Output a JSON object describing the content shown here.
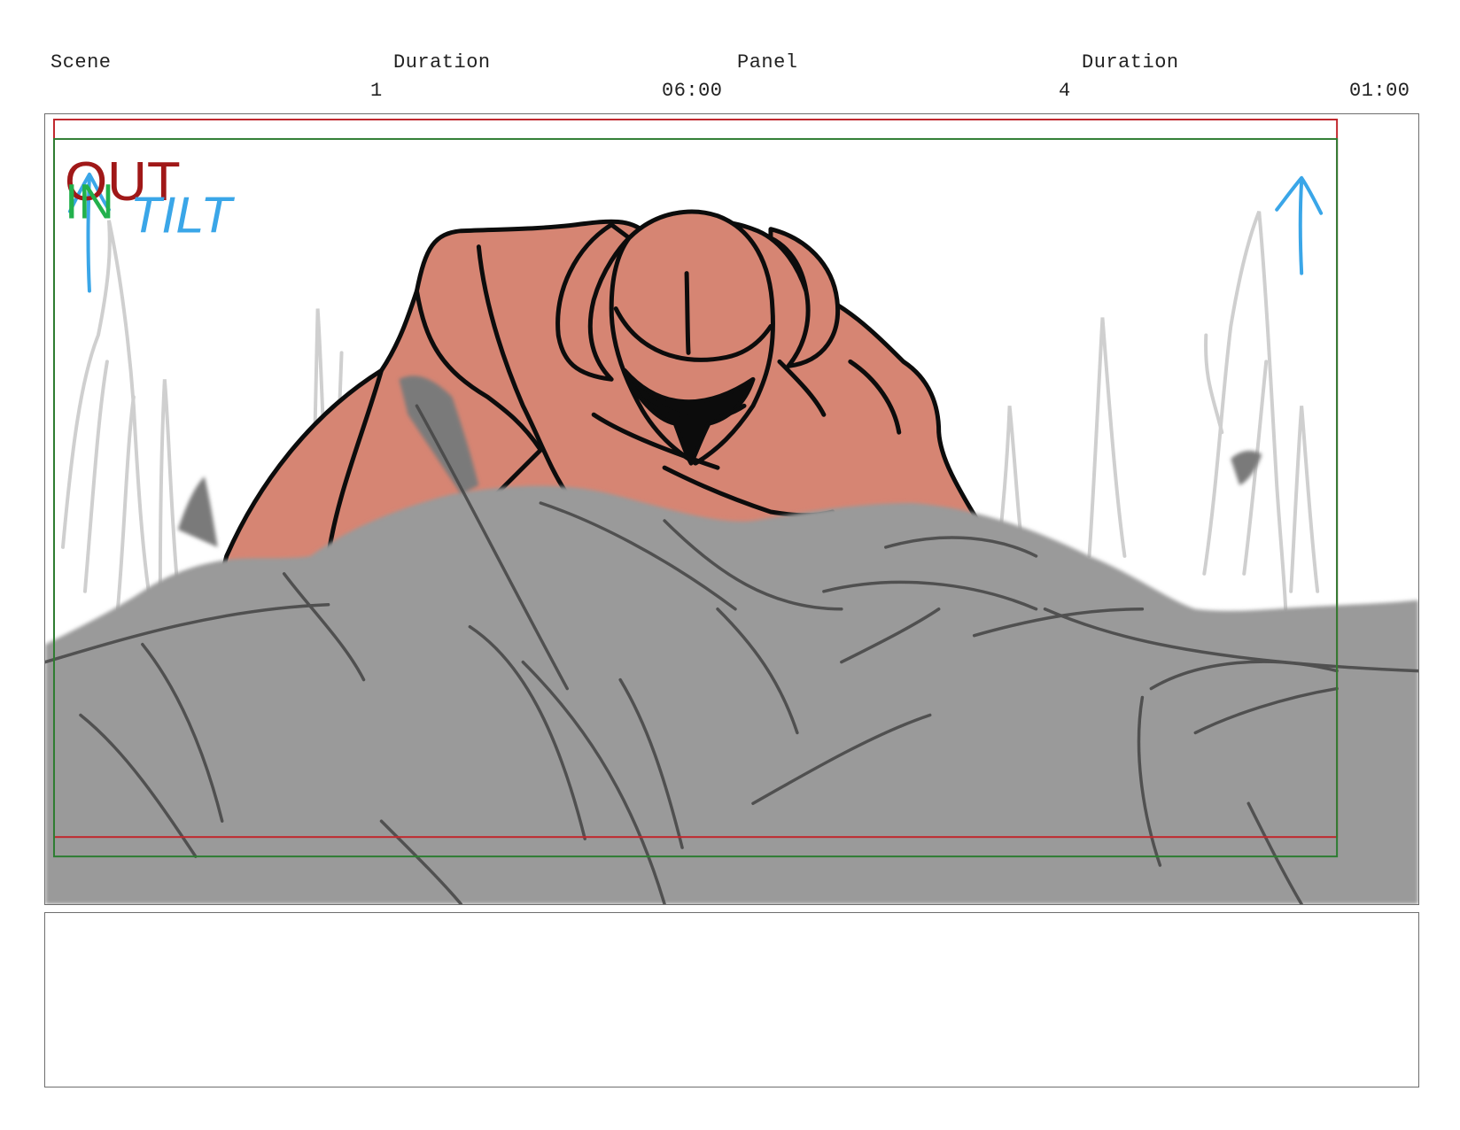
{
  "header": {
    "scene_label": "Scene",
    "scene_duration_label": "Duration",
    "panel_label": "Panel",
    "panel_duration_label": "Duration",
    "scene_number": "1",
    "scene_duration": "06:00",
    "panel_number": "4",
    "panel_duration": "01:00"
  },
  "panel_markers": {
    "out_label": "OUT",
    "in_label": "IN",
    "camera_move_label": "TILT"
  },
  "colors": {
    "safe_area_red": "#c0282d",
    "safe_area_green": "#2e7d32",
    "out_text": "#a01818",
    "in_text": "#22b14c",
    "camera_move": "#3aa6e8",
    "character_fill": "#d68573",
    "foreground_fill": "#9a9a9a",
    "background_sketch": "#c8c8c8"
  },
  "icons": {
    "camera_arrow_left": "up-arrow-icon",
    "camera_arrow_right": "up-arrow-icon"
  },
  "notes": {
    "text": ""
  }
}
